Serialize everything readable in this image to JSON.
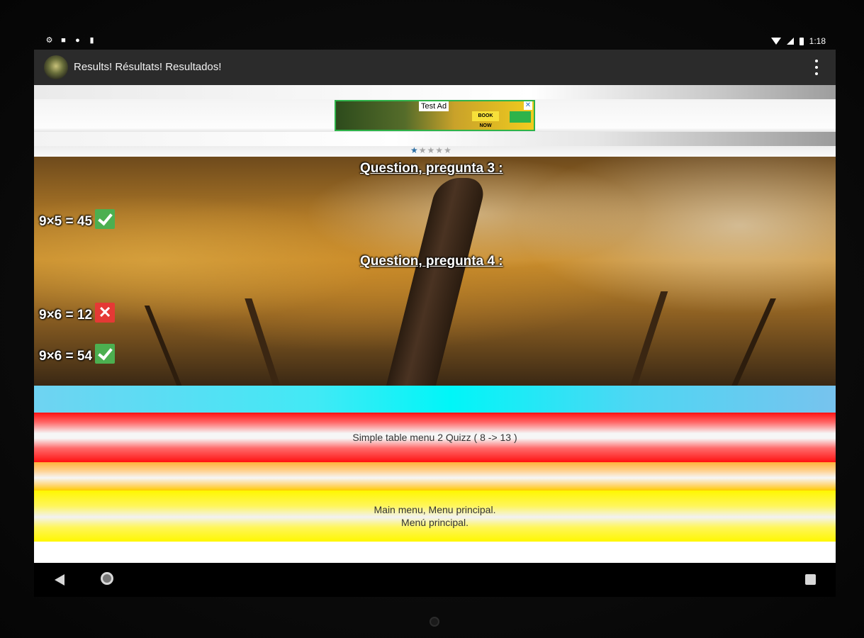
{
  "status_bar": {
    "left_icons": [
      "settings-icon",
      "notification-icon",
      "sync-icon",
      "sd-card-icon"
    ],
    "time": "1:18"
  },
  "app_bar": {
    "title": "Results! Résultats! Resultados!"
  },
  "ad": {
    "label": "Test Ad",
    "close": "✕",
    "cta": "BOOK NOW"
  },
  "rating": {
    "filled": 1,
    "total": 5
  },
  "quiz": {
    "questions": [
      {
        "label": "Question, pregunta 3 :"
      },
      {
        "label": "Question, pregunta 4 :"
      }
    ],
    "answers": [
      {
        "text": "9×5 = 45",
        "correct": true
      },
      {
        "text": "9×6 = 12",
        "correct": false
      },
      {
        "text": "9×6 = 54",
        "correct": true
      }
    ]
  },
  "menu": {
    "simple_table_button": "Simple table menu 2 Quizz ( 8 -> 13 )",
    "main_menu_line1": "Main menu, Menu principal.",
    "main_menu_line2": "Menú principal."
  },
  "colors": {
    "correct": "#4caf50",
    "wrong": "#e53935",
    "app_bar": "#2b2b2b"
  }
}
